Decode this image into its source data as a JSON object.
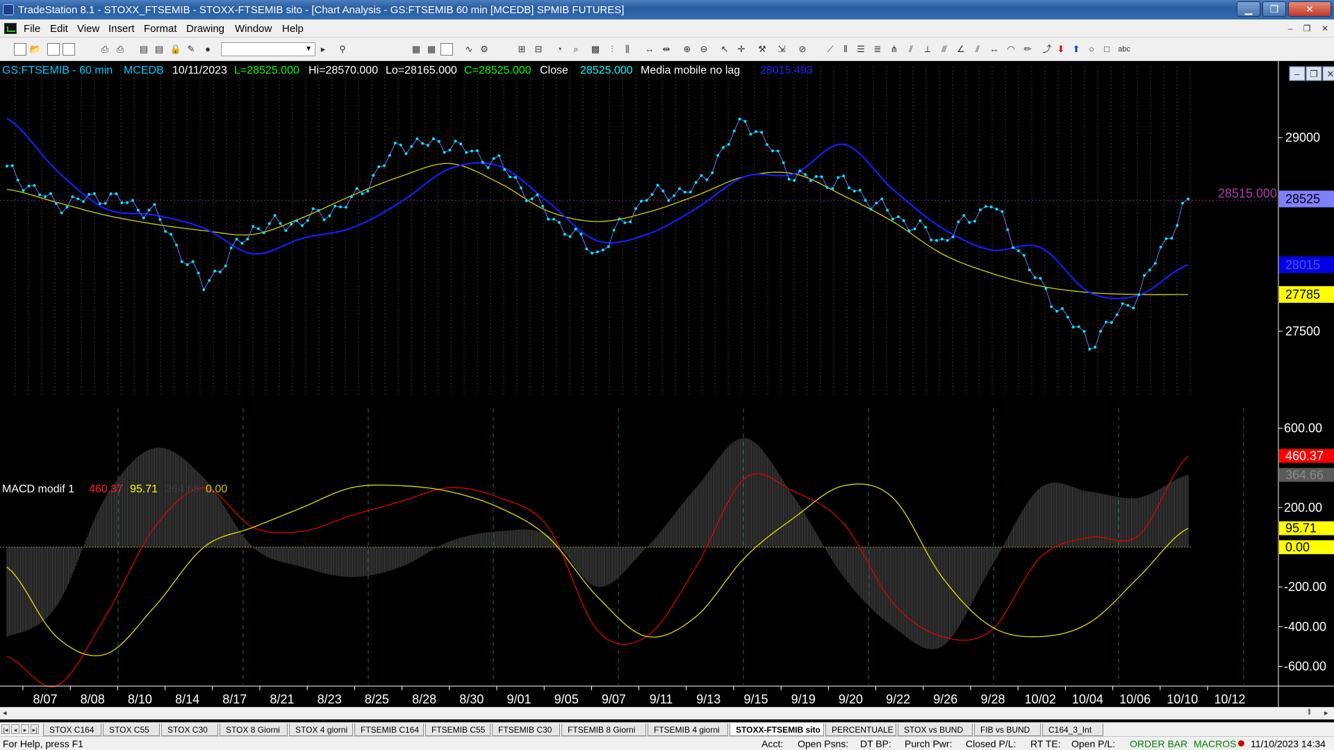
{
  "window": {
    "title": "TradeStation 8.1 - STOXX_FTSEMIB - STOXX-FTSEMIB sito - [Chart Analysis - GS:FTSEMIB  60 min  [MCEDB] SPMIB FUTURES]",
    "minimize": "▁",
    "maximize": "❐",
    "close": "✕",
    "mdi_minimize": "–",
    "mdi_restore": "❐",
    "mdi_close": "✕"
  },
  "menu": [
    "File",
    "Edit",
    "View",
    "Insert",
    "Format",
    "Drawing",
    "Window",
    "Help"
  ],
  "toolbar": {
    "icons": [
      "new-file-icon",
      "open-icon",
      "save-icon",
      "copy-icon",
      "print-icon",
      "print-preview-icon",
      "zoom-in-icon",
      "zoom-out-icon",
      "pointer-icon",
      "trendline-icon",
      "fibonacci-icon",
      "text-icon"
    ],
    "symbol_value": "",
    "text_tool_label": "abc"
  },
  "chart_header": {
    "symbol": "GS:FTSEMIB - 60 min",
    "data_source": "MCEDB",
    "date": "10/11/2023",
    "last": "L=28525.000",
    "high": "Hi=28570.000",
    "low": "Lo=28165.000",
    "close": "C=28525.000",
    "close_label": "Close",
    "close_value": "28525.000",
    "ma_label": "Media mobile no lag",
    "ma_value": "28015.493",
    "colors": {
      "symbol": "#00c8ff",
      "last": "#00ff00",
      "close_field": "#00ff00",
      "close_value": "#00ffff",
      "ma_value": "#2020ff",
      "text": "#ffffff"
    }
  },
  "price_axis": {
    "ticks": [
      "29000",
      "27500"
    ],
    "hline_label": "28515.000",
    "markers": [
      {
        "label": "28525",
        "bg": "#8080ff",
        "fg": "#000000"
      },
      {
        "label": "28015",
        "bg": "#0000e0",
        "fg": "#5050ff"
      },
      {
        "label": "27785",
        "bg": "#ffff00",
        "fg": "#000000"
      }
    ]
  },
  "macd_header": {
    "name": "MACD modif 1",
    "v1": "460.37",
    "v2": "95.71",
    "v3": "364.66",
    "v4": "0.00"
  },
  "macd_axis": {
    "ticks": [
      "600.00",
      "200.00",
      "-200.00",
      "-400.00",
      "-600.00"
    ],
    "markers": [
      {
        "label": "460.37",
        "bg": "#ff0000",
        "fg": "#ffffff"
      },
      {
        "label": "364.66",
        "bg": "#5a5a5a",
        "fg": "#8a8a8a"
      },
      {
        "label": "95.71",
        "bg": "#ffff00",
        "fg": "#000000"
      },
      {
        "label": "0.00",
        "bg": "#ffff00",
        "fg": "#000000"
      }
    ]
  },
  "date_axis": [
    "8/07",
    "8/08",
    "8/10",
    "8/14",
    "8/17",
    "8/21",
    "8/23",
    "8/25",
    "8/28",
    "8/30",
    "9/01",
    "9/05",
    "9/07",
    "9/11",
    "9/13",
    "9/15",
    "9/19",
    "9/20",
    "9/22",
    "9/26",
    "9/28",
    "10/02",
    "10/04",
    "10/06",
    "10/10",
    "10/12"
  ],
  "chart_data": [
    {
      "type": "line",
      "title": "GS:FTSEMIB - 60 min",
      "series_colors": {
        "close": "#00e5ff",
        "ma_blue": "#1a1aff",
        "ma_yellow": "#d4d400"
      },
      "ylim": [
        27000,
        29550
      ],
      "x": [
        "8/07",
        "8/08",
        "8/10",
        "8/14",
        "8/17",
        "8/21",
        "8/23",
        "8/25",
        "8/28",
        "8/30",
        "9/01",
        "9/05",
        "9/07",
        "9/11",
        "9/13",
        "9/15",
        "9/19",
        "9/20",
        "9/22",
        "9/26",
        "9/28",
        "10/02",
        "10/04",
        "10/06",
        "10/10"
      ],
      "series": [
        {
          "name": "Close",
          "values": [
            28750,
            28480,
            28550,
            28420,
            27850,
            28300,
            28350,
            28500,
            28950,
            28950,
            28800,
            28400,
            28100,
            28550,
            28600,
            29150,
            28700,
            28650,
            28400,
            28200,
            28500,
            27850,
            27400,
            27800,
            28525
          ]
        },
        {
          "name": "Media mobile no lag",
          "values": [
            29150,
            28750,
            28450,
            28400,
            28300,
            28100,
            28220,
            28300,
            28500,
            28760,
            28780,
            28500,
            28200,
            28250,
            28450,
            28700,
            28720,
            28950,
            28600,
            28300,
            28130,
            28150,
            27800,
            27780,
            28015
          ]
        },
        {
          "values": [
            28600,
            28500,
            28400,
            28330,
            28280,
            28250,
            28380,
            28550,
            28700,
            28800,
            28650,
            28430,
            28350,
            28420,
            28550,
            28700,
            28720,
            28550,
            28350,
            28100,
            27950,
            27850,
            27800,
            27785,
            27785
          ]
        }
      ]
    },
    {
      "type": "line",
      "title": "MACD modif 1",
      "ylim": [
        -700,
        700
      ],
      "x": [
        "8/07",
        "8/08",
        "8/10",
        "8/14",
        "8/17",
        "8/21",
        "8/23",
        "8/25",
        "8/28",
        "8/30",
        "9/01",
        "9/05",
        "9/07",
        "9/11",
        "9/13",
        "9/15",
        "9/19",
        "9/20",
        "9/22",
        "9/26",
        "9/28",
        "10/02",
        "10/04",
        "10/06",
        "10/10"
      ],
      "series": [
        {
          "values": [
            -550,
            -700,
            -350,
            100,
            300,
            100,
            80,
            160,
            230,
            300,
            250,
            100,
            -420,
            -450,
            -100,
            350,
            280,
            120,
            -280,
            -450,
            -420,
            -50,
            50,
            60,
            460.37
          ]
        },
        {
          "values": [
            -100,
            -450,
            -540,
            -300,
            0,
            100,
            200,
            300,
            310,
            280,
            200,
            50,
            -250,
            -450,
            -350,
            -50,
            150,
            310,
            250,
            -150,
            -400,
            -450,
            -380,
            -150,
            95.71
          ]
        },
        {
          "values": [
            -450,
            -300,
            250,
            500,
            350,
            0,
            -100,
            -150,
            -100,
            30,
            80,
            60,
            -200,
            0,
            300,
            550,
            250,
            -150,
            -400,
            -500,
            -100,
            300,
            280,
            250,
            364.66
          ]
        }
      ]
    }
  ],
  "sheet_tabs": [
    "STOX C164",
    "STOX C55",
    "STOX  C30",
    "STOX  8 Giorni",
    "STOX 4 giorni",
    "FTSEMIB C164",
    "FTSEMIB C55",
    "FTSEMIB C30",
    "FTSEMIB  8 Giorni",
    "FTSEMIB  4 giorni",
    "STOXX-FTSEMIB sito",
    "PERCENTUALE",
    "STOX vs BUND",
    "FIB vs BUND",
    "C164_3_Int"
  ],
  "active_tab": "STOXX-FTSEMIB sito",
  "status": {
    "help": "For Help, press F1",
    "acct": "Acct:",
    "open_psns": "Open Psns:",
    "dt_bp": "DT BP:",
    "purch_pwr": "Purch Pwr:",
    "closed_pl": "Closed P/L:",
    "rt_te": "RT TE:",
    "open_pl": "Open P/L:",
    "order_bar": "ORDER BAR",
    "macros": "MACROS",
    "datetime": "11/10/2023 14:34"
  }
}
